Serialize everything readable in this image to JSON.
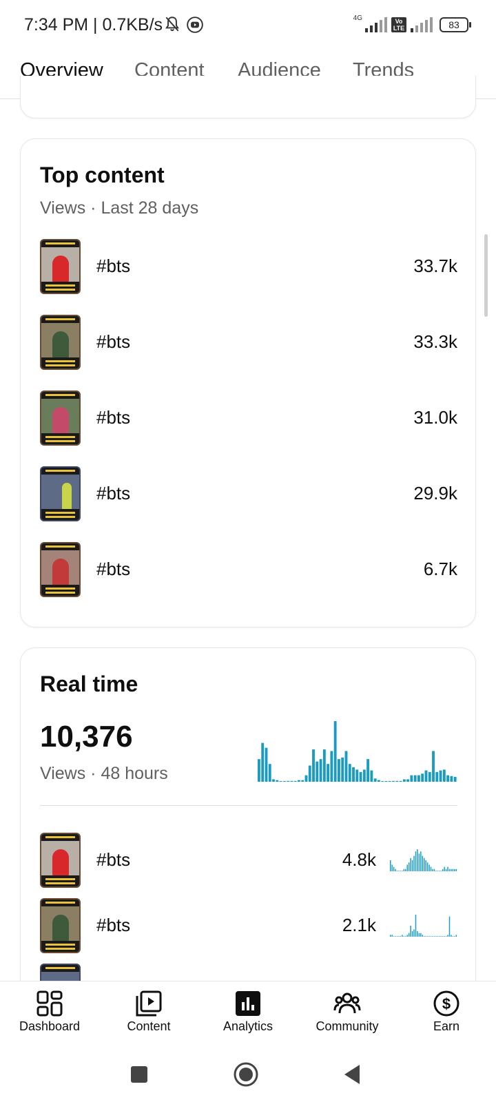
{
  "status_bar": {
    "time": "7:34 PM | 0.7KB/s",
    "network": "4G",
    "volte": "Vo LTE",
    "battery": "83"
  },
  "tabs": [
    {
      "label": "Overview",
      "active": true
    },
    {
      "label": "Content",
      "active": false
    },
    {
      "label": "Audience",
      "active": false
    },
    {
      "label": "Trends",
      "active": false
    }
  ],
  "top_content": {
    "title": "Top content",
    "subtitle": "Views · Last 28 days",
    "items": [
      {
        "title": "#bts",
        "views": "33.7k"
      },
      {
        "title": "#bts",
        "views": "33.3k"
      },
      {
        "title": "#bts",
        "views": "31.0k"
      },
      {
        "title": "#bts",
        "views": "29.9k"
      },
      {
        "title": "#bts",
        "views": "6.7k"
      }
    ]
  },
  "real_time": {
    "title": "Real time",
    "total": "10,376",
    "subtitle": "Views · 48 hours",
    "chart_data": {
      "type": "bar",
      "values": [
        28,
        48,
        42,
        22,
        3,
        2,
        0,
        0,
        1,
        1,
        1,
        2,
        2,
        8,
        20,
        40,
        25,
        28,
        40,
        22,
        38,
        75,
        28,
        30,
        38,
        22,
        18,
        15,
        12,
        15,
        28,
        14,
        4,
        2,
        0,
        0,
        0,
        1,
        1,
        1,
        3,
        3,
        8,
        8,
        8,
        10,
        14,
        12,
        38,
        12,
        14,
        15,
        8,
        7,
        6
      ],
      "color": "#1a9bc2"
    },
    "items": [
      {
        "title": "#bts",
        "views": "4.8k",
        "spark": [
          5,
          3,
          2,
          1,
          0,
          0,
          0,
          0,
          1,
          1,
          3,
          4,
          6,
          5,
          7,
          9,
          10,
          8,
          9,
          7,
          6,
          5,
          4,
          3,
          2,
          1,
          1,
          0,
          0,
          0,
          0,
          1,
          2,
          1,
          2,
          1,
          1,
          1,
          1,
          1
        ]
      },
      {
        "title": "#bts",
        "views": "2.1k",
        "spark": [
          1,
          1,
          0,
          0,
          0,
          0,
          0,
          1,
          0,
          0,
          1,
          2,
          6,
          3,
          4,
          12,
          3,
          2,
          2,
          1,
          0,
          0,
          0,
          0,
          0,
          0,
          0,
          0,
          0,
          0,
          0,
          0,
          0,
          0,
          1,
          11,
          1,
          0,
          0,
          1
        ]
      }
    ]
  },
  "bottom_nav": [
    {
      "label": "Dashboard",
      "icon": "dashboard-icon"
    },
    {
      "label": "Content",
      "icon": "content-icon"
    },
    {
      "label": "Analytics",
      "icon": "analytics-icon",
      "active": true
    },
    {
      "label": "Community",
      "icon": "community-icon"
    },
    {
      "label": "Earn",
      "icon": "earn-icon"
    }
  ]
}
